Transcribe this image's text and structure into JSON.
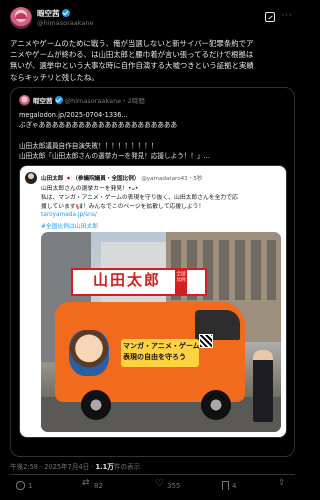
{
  "post": {
    "author_name": "暇空茜",
    "author_handle": "@himasoraakane",
    "text": "アニメやゲームのために戦う、俺が当選しないと新サイバー犯罪条約でア\nニメやゲームが終わる、は山田太郎と腰巾着が言い張ってるだけで根拠は\n無いが、選挙中という大事な時に自作自演する大嘘つきという証拠と実績\nならキッチリと残したね。"
  },
  "quote": {
    "author_name": "暇空茜",
    "author_handle": "@himasoraakane",
    "time": "・2時間",
    "text": "megalodon.jp/2025-0704-1336...\nぶぎゃあああああああああああああああああああああ\n\n山田太郎議員自作自演失敗！！！！！！！！！\n山田太郎「山田太郎さんの選挙カーを発見！応援しよう！！」..."
  },
  "inner_post": {
    "author_name": "山田太郎 🇯🇵（参議院議員・全国比例）",
    "author_handle": "@yamadataro43",
    "time": "・5秒",
    "text": "山田太郎さんの選挙カーを発見！•ᴗ•\n私は、マンガ・アニメ・ゲームの表現を守り抜く、山田太郎さんを全力で応\n援しています📢！みんなでこのページを拡散して応援しよう！",
    "link": "taroyamada.jp/sns/",
    "hashtag": "#全国比例は山田太郎",
    "image": {
      "roof_sign": "山田太郎",
      "roof_side": "全国比例",
      "slogan_line1": "マンガ・アニメ・ゲーム",
      "slogan_line2": "表現の自由を守ろう"
    }
  },
  "meta": {
    "time": "午後2:58 · 2025年7月4日 · ",
    "views_count": "1.1万",
    "views_label": "件の表示"
  },
  "actions": {
    "reply": "1",
    "retweet": "82",
    "like": "355",
    "bookmark": "4"
  }
}
